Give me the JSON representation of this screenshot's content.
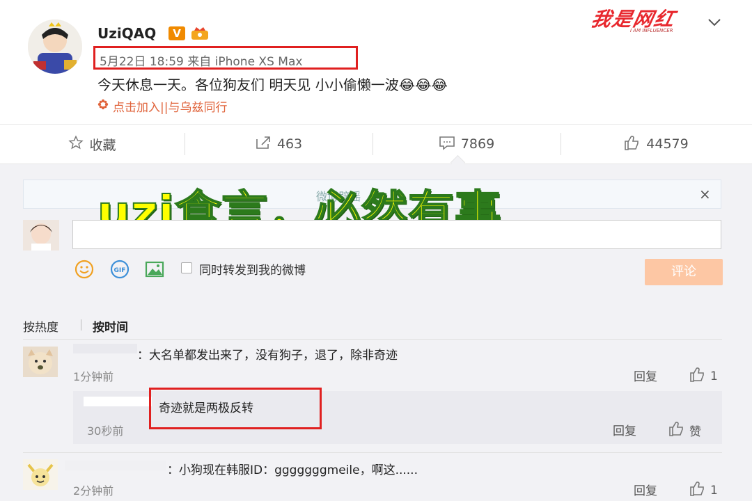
{
  "post": {
    "username": "UziQAQ",
    "vip_badge": "V",
    "meta": "5月22日 18:59 来自 iPhone XS Max",
    "text": "今天休息一天。各位狗友们 明天见 小小偷懒一波😂😂😂",
    "join_text": "点击加入||与乌兹同行",
    "brand": "我是网红",
    "brand_sub": "I AM INFLUENCER"
  },
  "actions": {
    "favorite": "收藏",
    "repost_count": "463",
    "comment_count": "7869",
    "like_count": "44579"
  },
  "notice": {
    "text": "微博辟谣",
    "close": "×"
  },
  "overlay_caption": "uzi食言，必然有事",
  "composer": {
    "checkbox_label": "同时转发到我的微博",
    "submit_label": "评论",
    "input_value": ""
  },
  "sort": {
    "by_heat": "按热度",
    "by_time": "按时间"
  },
  "comments": [
    {
      "text": "：大名单都发出来了，没有狗子，退了，除非奇迹",
      "time": "1分钟前",
      "reply_label": "回复",
      "likes": "1",
      "reply": {
        "text": "奇迹就是两极反转",
        "time": "30秒前",
        "reply_label": "回复",
        "like_label": "赞"
      }
    },
    {
      "text": "：小狗现在韩服ID：gggggggmeile，啊这......",
      "time": "2分钟前",
      "reply_label": "回复",
      "likes": "1"
    }
  ],
  "colors": {
    "highlight_red": "#e02020",
    "overlay_yellow": "#ffff00",
    "submit_orange": "#fdc7a4",
    "join_orange": "#e0643c"
  }
}
